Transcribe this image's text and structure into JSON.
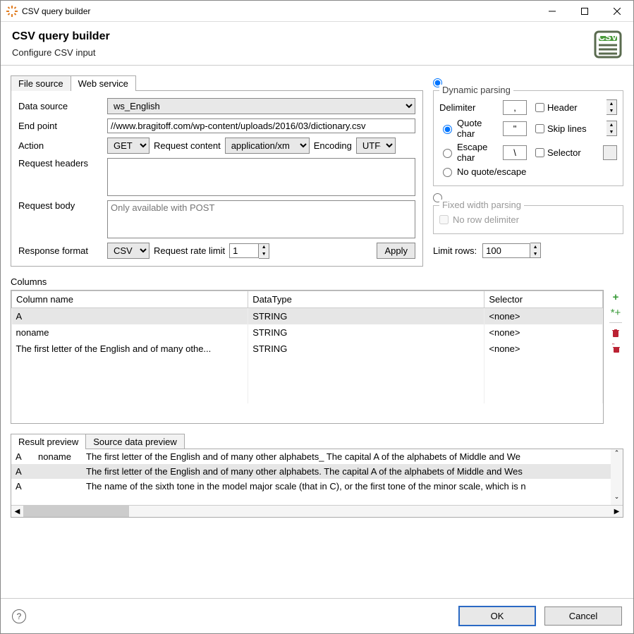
{
  "window": {
    "title": "CSV query builder"
  },
  "header": {
    "title": "CSV query builder",
    "subtitle": "Configure CSV input"
  },
  "tabs": {
    "file_source": "File source",
    "web_service": "Web service"
  },
  "form": {
    "data_source_label": "Data source",
    "data_source_value": "ws_English",
    "end_point_label": "End point",
    "end_point_value": "//www.bragitoff.com/wp-content/uploads/2016/03/dictionary.csv",
    "action_label": "Action",
    "action_value": "GET",
    "request_content_label": "Request content",
    "request_content_value": "application/xm",
    "encoding_label": "Encoding",
    "encoding_value": "UTF-",
    "request_headers_label": "Request headers",
    "request_headers_value": "",
    "request_body_label": "Request body",
    "request_body_placeholder": "Only available with POST",
    "response_format_label": "Response format",
    "response_format_value": "CSV",
    "request_rate_label": "Request rate limit",
    "request_rate_value": "1",
    "apply_label": "Apply"
  },
  "parsing": {
    "dynamic_legend": "Dynamic parsing",
    "delimiter_label": "Delimiter",
    "delimiter_value": ",",
    "header_label": "Header",
    "quote_label": "Quote char",
    "quote_value": "\"",
    "skip_label": "Skip lines",
    "escape_label": "Escape char",
    "escape_value": "\\",
    "selector_label": "Selector",
    "none_label": "No quote/escape",
    "fixed_legend": "Fixed width parsing",
    "fixed_inner": "No row delimiter",
    "limit_label": "Limit rows:",
    "limit_value": "100"
  },
  "columns": {
    "section_label": "Columns",
    "headers": {
      "name": "Column name",
      "type": "DataType",
      "selector": "Selector"
    },
    "rows": [
      {
        "name": "A",
        "type": "STRING",
        "selector": "<none>"
      },
      {
        "name": "noname",
        "type": "STRING",
        "selector": "<none>"
      },
      {
        "name": "The first letter of the English and of many othe...",
        "type": "STRING",
        "selector": "<none>"
      }
    ]
  },
  "preview": {
    "tab_result": "Result preview",
    "tab_source": "Source data preview",
    "rows": [
      {
        "c0": "A",
        "c1": "noname",
        "c2": "The first letter of the English and of many other alphabets_ The capital A of the alphabets of Middle and We"
      },
      {
        "c0": "A",
        "c1": "",
        "c2": "The first letter of the English and of many other alphabets. The capital A of the alphabets of Middle and Wes"
      },
      {
        "c0": "A",
        "c1": "",
        "c2": "The name of the sixth tone in the model major scale (that in C), or the first tone of the minor scale, which is n"
      }
    ]
  },
  "footer": {
    "ok": "OK",
    "cancel": "Cancel"
  }
}
